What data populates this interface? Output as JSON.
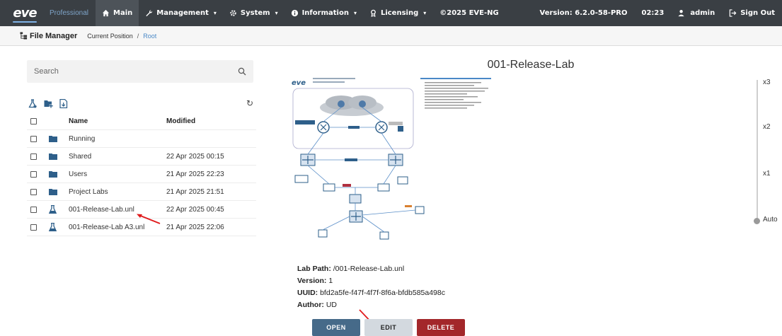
{
  "nav": {
    "logo": "eve",
    "edition": "Professional",
    "items": [
      {
        "label": "Main",
        "icon": "home-icon",
        "caret": false
      },
      {
        "label": "Management",
        "icon": "wrench-icon",
        "caret": true
      },
      {
        "label": "System",
        "icon": "gear-icon",
        "caret": true
      },
      {
        "label": "Information",
        "icon": "info-icon",
        "caret": true
      },
      {
        "label": "Licensing",
        "icon": "license-icon",
        "caret": true
      }
    ],
    "copyright": "©2025 EVE-NG",
    "version": "Version: 6.2.0-58-PRO",
    "time": "02:23",
    "user": "admin",
    "signout": "Sign Out"
  },
  "file_manager": {
    "title": "File Manager",
    "breadcrumb_label": "Current Position",
    "breadcrumb_sep": "/",
    "breadcrumb_root": "Root"
  },
  "search": {
    "placeholder": "Search"
  },
  "table": {
    "col_name": "Name",
    "col_modified": "Modified",
    "rows": [
      {
        "type": "folder",
        "name": "Running",
        "modified": ""
      },
      {
        "type": "folder",
        "name": "Shared",
        "modified": "22 Apr 2025 00:15"
      },
      {
        "type": "folder",
        "name": "Users",
        "modified": "21 Apr 2025 22:23"
      },
      {
        "type": "folder",
        "name": "Project Labs",
        "modified": "21 Apr 2025 21:51"
      },
      {
        "type": "lab",
        "name": "001-Release-Lab.unl",
        "modified": "22 Apr 2025 00:45"
      },
      {
        "type": "lab",
        "name": "001-Release-Lab A3.unl",
        "modified": "21 Apr 2025 22:06"
      }
    ]
  },
  "preview": {
    "title": "001-Release-Lab",
    "path_label": "Lab Path:",
    "path": "/001-Release-Lab.unl",
    "version_label": "Version:",
    "version": "1",
    "uuid_label": "UUID:",
    "uuid": "bfd2a5fe-f47f-4f7f-8f6a-bfdb585a498c",
    "author_label": "Author:",
    "author": "UD"
  },
  "buttons": {
    "open": "OPEN",
    "edit": "EDIT",
    "delete": "DELETE"
  },
  "zoom": {
    "levels": [
      "x3",
      "x2",
      "x1",
      "Auto"
    ],
    "selected": "Auto"
  },
  "colors": {
    "nav_bg": "#3a3f44",
    "open": "#466a89",
    "delete": "#a3272a",
    "link": "#4a88c7"
  }
}
